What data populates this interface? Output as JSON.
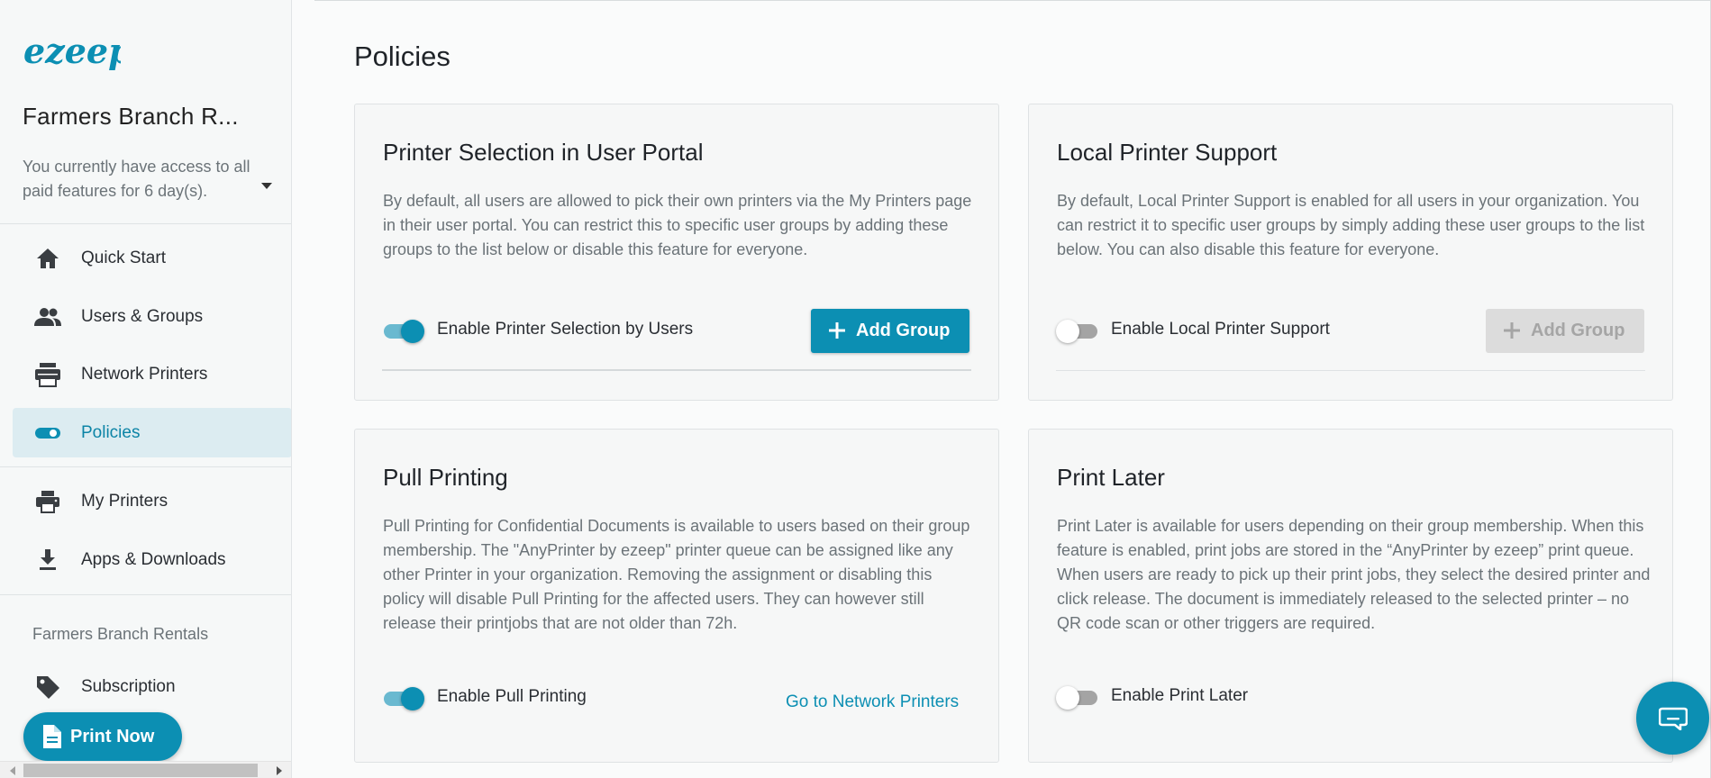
{
  "sidebar": {
    "logo_text": "ezeep",
    "org_name": "Farmers Branch R...",
    "trial_text": "You currently have access to all paid features for 6 day(s).",
    "nav_main": [
      {
        "label": "Quick Start",
        "icon": "home-icon"
      },
      {
        "label": "Users & Groups",
        "icon": "users-icon"
      },
      {
        "label": "Network Printers",
        "icon": "network-printers-icon"
      },
      {
        "label": "Policies",
        "icon": "toggle-icon",
        "active": true
      }
    ],
    "nav_secondary": [
      {
        "label": "My Printers",
        "icon": "printer-icon"
      },
      {
        "label": "Apps & Downloads",
        "icon": "download-icon"
      }
    ],
    "section_label": "Farmers Branch Rentals",
    "nav_account": [
      {
        "label": "Subscription",
        "icon": "tag-icon"
      }
    ],
    "print_now_label": "Print Now"
  },
  "main": {
    "title": "Policies",
    "cards": [
      {
        "title": "Printer Selection in User Portal",
        "description": "By default, all users are allowed to pick their own printers via the My Printers page in their user portal. You can restrict this to specific user groups by adding these groups to the list below or disable this feature for everyone.",
        "toggle_label": "Enable Printer Selection by Users",
        "toggle_on": true,
        "button_label": "Add Group",
        "button_enabled": true
      },
      {
        "title": "Local Printer Support",
        "description": "By default, Local Printer Support is enabled for all users in your organization. You can restrict it to specific user groups by simply adding these user groups to the list below. You can also disable this feature for everyone.",
        "toggle_label": "Enable Local Printer Support",
        "toggle_on": false,
        "button_label": "Add Group",
        "button_enabled": false
      },
      {
        "title": "Pull Printing",
        "description": "Pull Printing for Confidential Documents is available to users based on their group membership. The \"AnyPrinter by ezeep\" printer queue can be assigned like any other Printer in your organization. Removing the assignment or disabling this policy will disable Pull Printing for the affected users. They can however still release their printjobs that are not older than 72h.",
        "toggle_label": "Enable Pull Printing",
        "toggle_on": true,
        "link_label": "Go to Network Printers"
      },
      {
        "title": "Print Later",
        "description": "Print Later is available for users depending on their group membership. When this feature is enabled, print jobs are stored in the “AnyPrinter by ezeep” print queue. When users are ready to pick up their print jobs, they select the desired printer and click release. The document is immediately released to the selected printer – no QR code scan or other triggers are required.",
        "toggle_label": "Enable Print Later",
        "toggle_on": false
      }
    ]
  },
  "colors": {
    "accent": "#0c8fb3",
    "active_bg": "#dcecf1",
    "text_muted": "#6b7378"
  },
  "chat_icon": "chat-icon"
}
